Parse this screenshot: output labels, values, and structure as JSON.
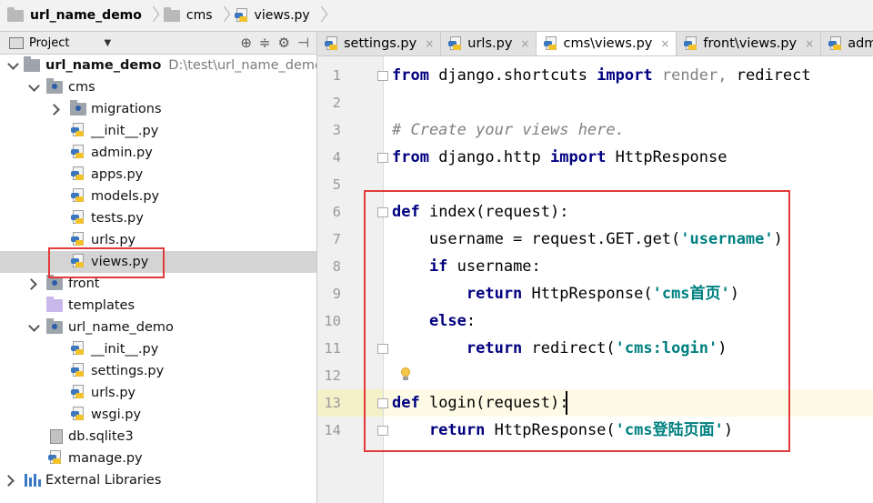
{
  "breadcrumb": [
    {
      "label": "url_name_demo",
      "icon": "folder-icon"
    },
    {
      "label": "cms",
      "icon": "folder-icon"
    },
    {
      "label": "views.py",
      "icon": "python-file-icon"
    }
  ],
  "project_panel": {
    "title": "Project",
    "tree": [
      {
        "label": "url_name_demo",
        "path": "D:\\test\\url_name_demo"
      },
      {
        "label": "cms"
      },
      {
        "label": "migrations"
      },
      {
        "label": "__init__.py"
      },
      {
        "label": "admin.py"
      },
      {
        "label": "apps.py"
      },
      {
        "label": "models.py"
      },
      {
        "label": "tests.py"
      },
      {
        "label": "urls.py"
      },
      {
        "label": "views.py"
      },
      {
        "label": "front"
      },
      {
        "label": "templates"
      },
      {
        "label": "url_name_demo"
      },
      {
        "label": "__init__.py"
      },
      {
        "label": "settings.py"
      },
      {
        "label": "urls.py"
      },
      {
        "label": "wsgi.py"
      },
      {
        "label": "db.sqlite3"
      },
      {
        "label": "manage.py"
      },
      {
        "label": "External Libraries"
      }
    ]
  },
  "tabs": [
    {
      "label": "settings.py"
    },
    {
      "label": "urls.py"
    },
    {
      "label": "cms\\views.py",
      "active": true
    },
    {
      "label": "front\\views.py"
    },
    {
      "label": "admin.py"
    }
  ],
  "tab_close_glyph": "×",
  "editor": {
    "line_numbers": [
      "1",
      "2",
      "3",
      "4",
      "5",
      "6",
      "7",
      "8",
      "9",
      "10",
      "11",
      "12",
      "13",
      "14"
    ],
    "current_line": "13",
    "tokens": {
      "l1_kw1": "from",
      "l1_mod": " django.shortcuts ",
      "l1_kw2": "import",
      "l1_rest": " render, ",
      "l1_redirect": "redirect",
      "l3_cmt": "# Create your views here.",
      "l4_kw1": "from",
      "l4_mod": " django.http ",
      "l4_kw2": "import",
      "l4_rest": " HttpResponse",
      "l6_kw": "def",
      "l6_rest": " index(request):",
      "l7_a": "    username = request.GET.get(",
      "l7_str": "'username'",
      "l7_b": ")",
      "l8_kw": "    if",
      "l8_rest": " username:",
      "l9_kw": "        return",
      "l9_a": " HttpResponse(",
      "l9_str": "'cms首页'",
      "l9_b": ")",
      "l10_kw": "    else",
      "l10_rest": ":",
      "l11_kw": "        return",
      "l11_a": " redirect(",
      "l11_str": "'cms:login'",
      "l11_b": ")",
      "l13_kw": "def",
      "l13_rest": " login(request):",
      "l14_kw": "    return",
      "l14_a": " HttpResponse(",
      "l14_str": "'cms登陆页面'",
      "l14_b": ")"
    }
  },
  "colors": {
    "keyword": "#000080",
    "string": "#008080",
    "comment": "#808080",
    "highlight_box": "#e23a3a"
  }
}
